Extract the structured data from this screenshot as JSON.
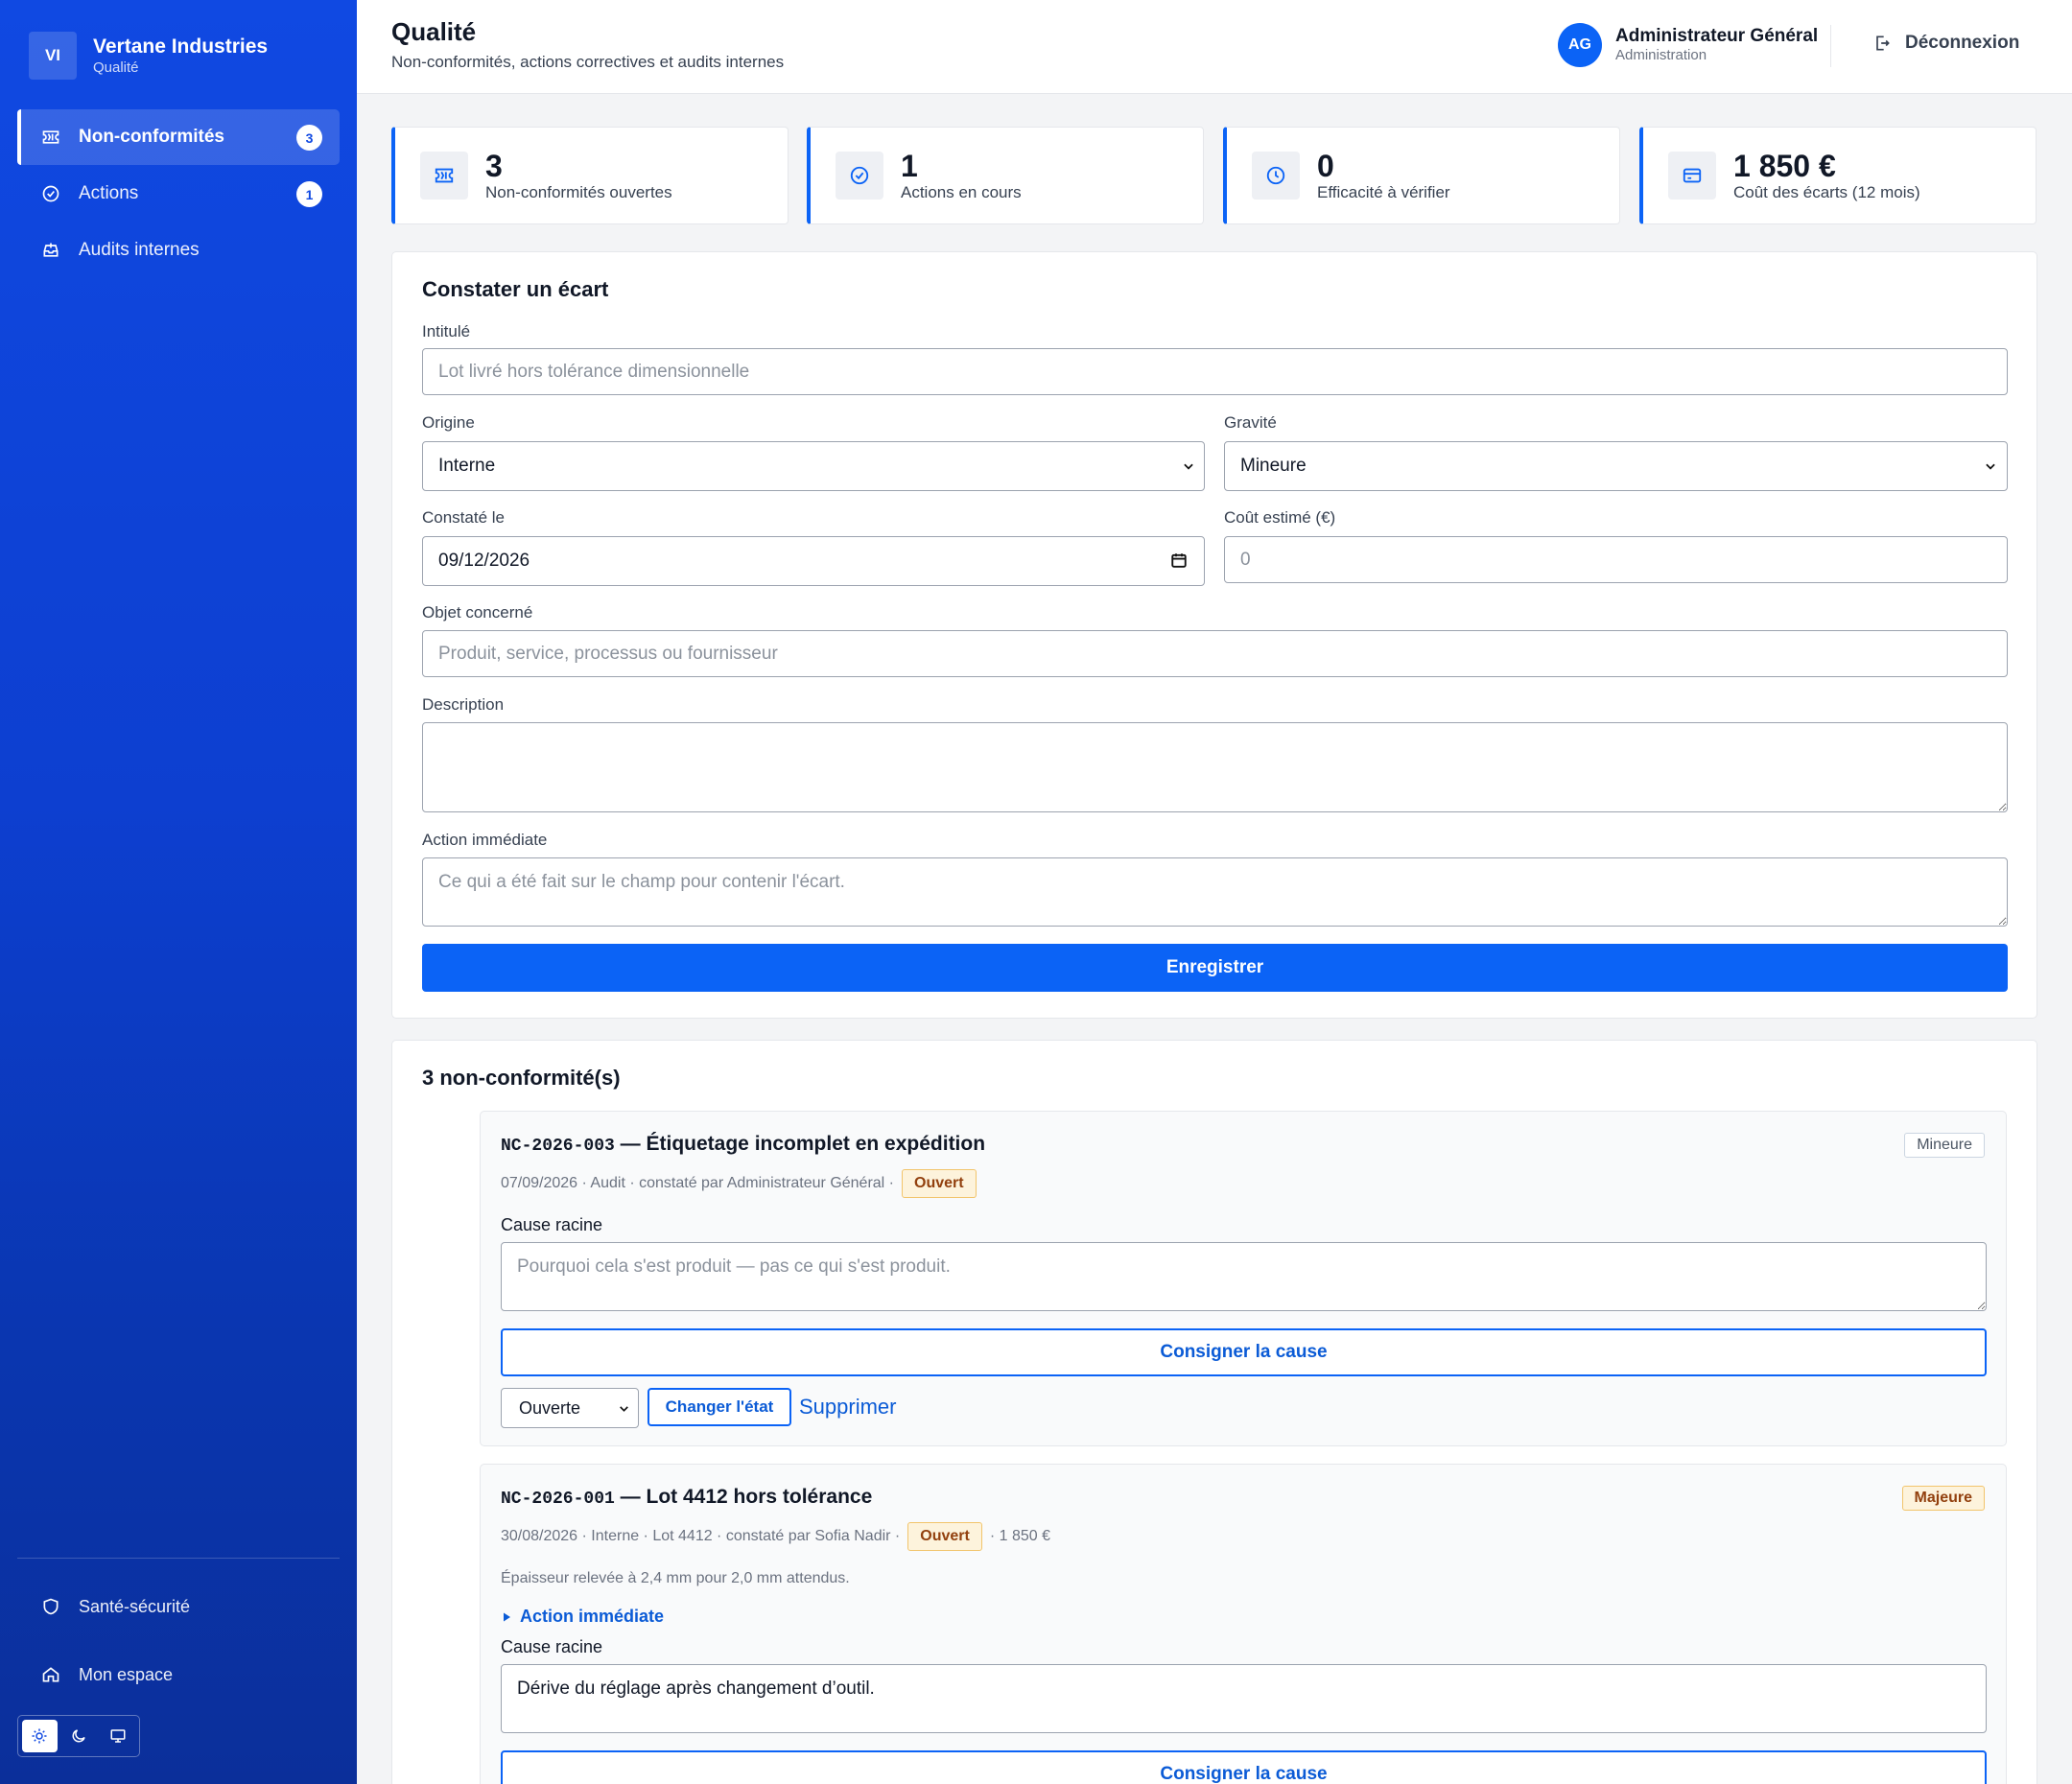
{
  "brand": {
    "initials": "VI",
    "name": "Vertane Industries",
    "module": "Qualité"
  },
  "nav": [
    {
      "label": "Non-conformités",
      "badge": "3",
      "icon": "ticket-icon",
      "active": true
    },
    {
      "label": "Actions",
      "badge": "1",
      "icon": "check-circle-icon"
    },
    {
      "label": "Audits internes",
      "icon": "inbox-icon"
    }
  ],
  "bottom_nav": [
    {
      "label": "Santé-sécurité",
      "icon": "shield-icon"
    },
    {
      "label": "Mon espace",
      "icon": "home-icon"
    }
  ],
  "theme": {
    "options": [
      "sun-icon",
      "moon-icon",
      "monitor-icon"
    ],
    "selected": "sun-icon"
  },
  "header": {
    "title": "Qualité",
    "subtitle": "Non-conformités, actions correctives et audits internes",
    "user": {
      "initials": "AG",
      "name": "Administrateur Général",
      "role": "Administration"
    },
    "logout_label": "Déconnexion"
  },
  "stats": [
    {
      "value": "3",
      "label": "Non-conformités ouvertes",
      "icon": "ticket-icon"
    },
    {
      "value": "1",
      "label": "Actions en cours",
      "icon": "check-circle-icon"
    },
    {
      "value": "0",
      "label": "Efficacité à vérifier",
      "icon": "clock-icon"
    },
    {
      "value": "1 850 €",
      "label": "Coût des écarts (12 mois)",
      "icon": "card-icon"
    }
  ],
  "form": {
    "title": "Constater un écart",
    "intitule": {
      "label": "Intitulé",
      "placeholder": "Lot livré hors tolérance dimensionnelle"
    },
    "origine": {
      "label": "Origine",
      "value": "Interne"
    },
    "gravite": {
      "label": "Gravité",
      "value": "Mineure"
    },
    "constate_le": {
      "label": "Constaté le",
      "value": "09/12/2026"
    },
    "cout": {
      "label": "Coût estimé (€)",
      "placeholder": "0"
    },
    "objet": {
      "label": "Objet concerné",
      "placeholder": "Produit, service, processus ou fournisseur"
    },
    "description": {
      "label": "Description",
      "placeholder": ""
    },
    "action": {
      "label": "Action immédiate",
      "placeholder": "Ce qui a été fait sur le champ pour contenir l'écart."
    },
    "submit": "Enregistrer"
  },
  "list": {
    "title": "3 non-conformité(s)",
    "items": [
      {
        "code": "NC-2026-003",
        "title": "— Étiquetage incomplet en expédition",
        "severity": "Mineure",
        "meta": "07/09/2026 · Audit · constaté par Administrateur Général ·",
        "status": "Ouvert",
        "cause_label": "Cause racine",
        "cause_placeholder": "Pourquoi cela s'est produit — pas ce qui s'est produit.",
        "cause_button": "Consigner la cause",
        "state_value": "Ouverte",
        "state_button": "Changer l'état",
        "delete_label": "Supprimer"
      },
      {
        "code": "NC-2026-001",
        "title": "— Lot 4412 hors tolérance",
        "severity": "Majeure",
        "meta": "30/08/2026 · Interne · Lot 4412 · constaté par Sofia Nadir ·",
        "status": "Ouvert",
        "meta_after": "· 1 850 €",
        "description": "Épaisseur relevée à 2,4 mm pour 2,0 mm attendus.",
        "details_label": "Action immédiate",
        "cause_label": "Cause racine",
        "cause_value": "Dérive du réglage après changement d’outil.",
        "cause_button": "Consigner la cause"
      }
    ]
  }
}
